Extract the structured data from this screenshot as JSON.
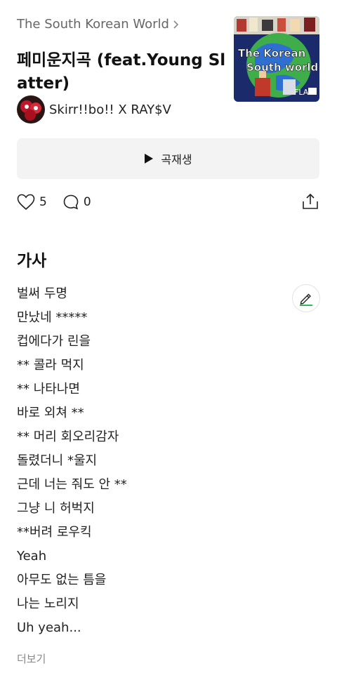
{
  "album": {
    "title": "The South Korean World"
  },
  "song": {
    "title": "페미운지곡 (feat.Young Slatter)"
  },
  "artist": {
    "name": "Skirr!!bo!! X RAY$V"
  },
  "cover_art": {
    "text_line1": "The Korean",
    "text_line2": "South world",
    "badge": "FLAC"
  },
  "play": {
    "label": "곡재생"
  },
  "actions": {
    "likes": "5",
    "comments": "0"
  },
  "lyrics": {
    "heading": "가사",
    "lines": [
      "벌써 두명",
      "만났네 *****",
      "컵에다가 린을",
      "** 콜라 먹지",
      "** 나타나면",
      "바로 외쳐 **",
      "** 머리 회오리감자",
      "돌렸더니 *울지",
      "근데 너는 줘도 안 **",
      "그냥 니 허벅지",
      "**버려 로우킥",
      "Yeah",
      "아무도 없는 틈을",
      "나는 노리지",
      "Uh yeah..."
    ],
    "more_label": "더보기"
  },
  "colors": {
    "play_bg": "#f3f3f3",
    "edit_accent": "#2dbb5c"
  },
  "icons": [
    "chevron-right-icon",
    "play-icon",
    "heart-icon",
    "comment-icon",
    "share-icon",
    "edit-lyrics-icon"
  ]
}
